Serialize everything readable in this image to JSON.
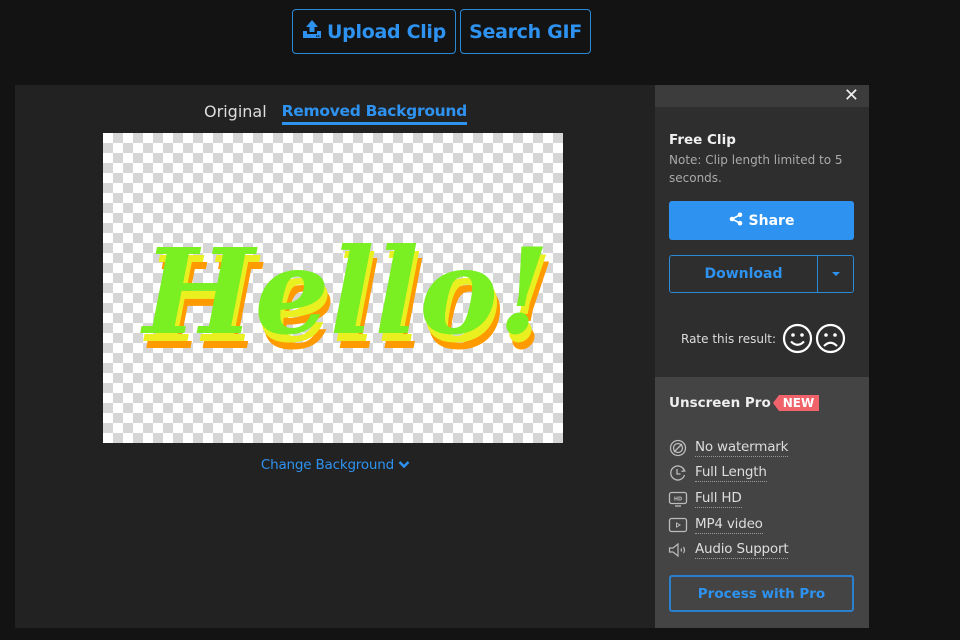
{
  "toolbar": {
    "upload_label": "Upload Clip",
    "upload_icon": "upload-icon",
    "search_label": "Search GIF"
  },
  "editor": {
    "tabs": [
      {
        "label": "Original",
        "active": false
      },
      {
        "label": "Removed Background",
        "active": true
      }
    ],
    "preview": {
      "background": "transparent-checkerboard",
      "text": "Hello!",
      "text_colors": {
        "front": "#7aef22",
        "middle": "#eaf020",
        "back": "#ff9a00"
      }
    },
    "change_background_label": "Change Background",
    "change_background_icon": "chevron-down-icon"
  },
  "sidebar": {
    "close_icon": "close-icon",
    "free_clip": {
      "title": "Free Clip",
      "note": "Note: Clip length limited to 5 seconds."
    },
    "share_label": "Share",
    "download_label": "Download",
    "rate_label": "Rate this result:",
    "pro": {
      "title": "Unscreen Pro",
      "badge": "NEW",
      "features": [
        {
          "icon": "no-watermark-icon",
          "label": "No watermark"
        },
        {
          "icon": "clock-icon",
          "label": "Full Length"
        },
        {
          "icon": "hd-monitor-icon",
          "label": "Full HD"
        },
        {
          "icon": "video-play-icon",
          "label": "MP4 video"
        },
        {
          "icon": "speaker-icon",
          "label": "Audio Support"
        }
      ],
      "process_label": "Process with Pro"
    }
  },
  "colors": {
    "accent": "#2e93f0",
    "badge": "#f0636b",
    "page_bg": "#131313",
    "panel_bg": "#222222",
    "sidebar_bg": "#2e2e2e",
    "pro_bg": "#444444"
  }
}
